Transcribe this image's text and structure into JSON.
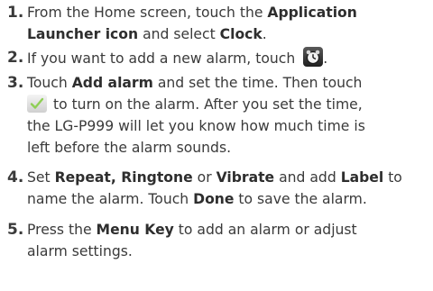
{
  "steps": [
    {
      "number": "1.",
      "lines": [
        [
          {
            "t": "From the Home screen, touch the "
          },
          {
            "t": "Application",
            "b": 1
          }
        ],
        [
          {
            "t": "Launcher icon",
            "b": 1
          },
          {
            "t": " and select "
          },
          {
            "t": "Clock",
            "b": 1
          },
          {
            "t": "."
          }
        ]
      ]
    },
    {
      "number": "2.",
      "lines": [
        [
          {
            "t": "If you want to add a new alarm, touch "
          },
          {
            "icon": "alarm-clock-icon"
          },
          {
            "t": "."
          }
        ]
      ]
    },
    {
      "number": "3.",
      "lines": [
        [
          {
            "t": "Touch "
          },
          {
            "t": "Add alarm",
            "b": 1
          },
          {
            "t": " and set the time. Then touch"
          }
        ],
        [
          {
            "icon": "checkmark-icon"
          },
          {
            "t": " to turn on the alarm. After you set the time,"
          }
        ],
        [
          {
            "t": "the LG-P999 will let you know how much time is"
          }
        ],
        [
          {
            "t": "left before the alarm sounds."
          }
        ]
      ]
    },
    {
      "number": "4.",
      "lines": [
        [
          {
            "t": "Set "
          },
          {
            "t": "Repeat, Ringtone",
            "b": 1
          },
          {
            "t": " or "
          },
          {
            "t": "Vibrate",
            "b": 1
          },
          {
            "t": " and add "
          },
          {
            "t": "Label",
            "b": 1
          },
          {
            "t": " to"
          }
        ],
        [
          {
            "t": "name the alarm. Touch "
          },
          {
            "t": "Done",
            "b": 1
          },
          {
            "t": " to save the alarm."
          }
        ]
      ]
    },
    {
      "number": "5.",
      "lines": [
        [
          {
            "t": "Press the "
          },
          {
            "t": "Menu Key",
            "b": 1
          },
          {
            "t": " to add an alarm or adjust"
          }
        ],
        [
          {
            "t": "alarm settings."
          }
        ]
      ]
    }
  ]
}
